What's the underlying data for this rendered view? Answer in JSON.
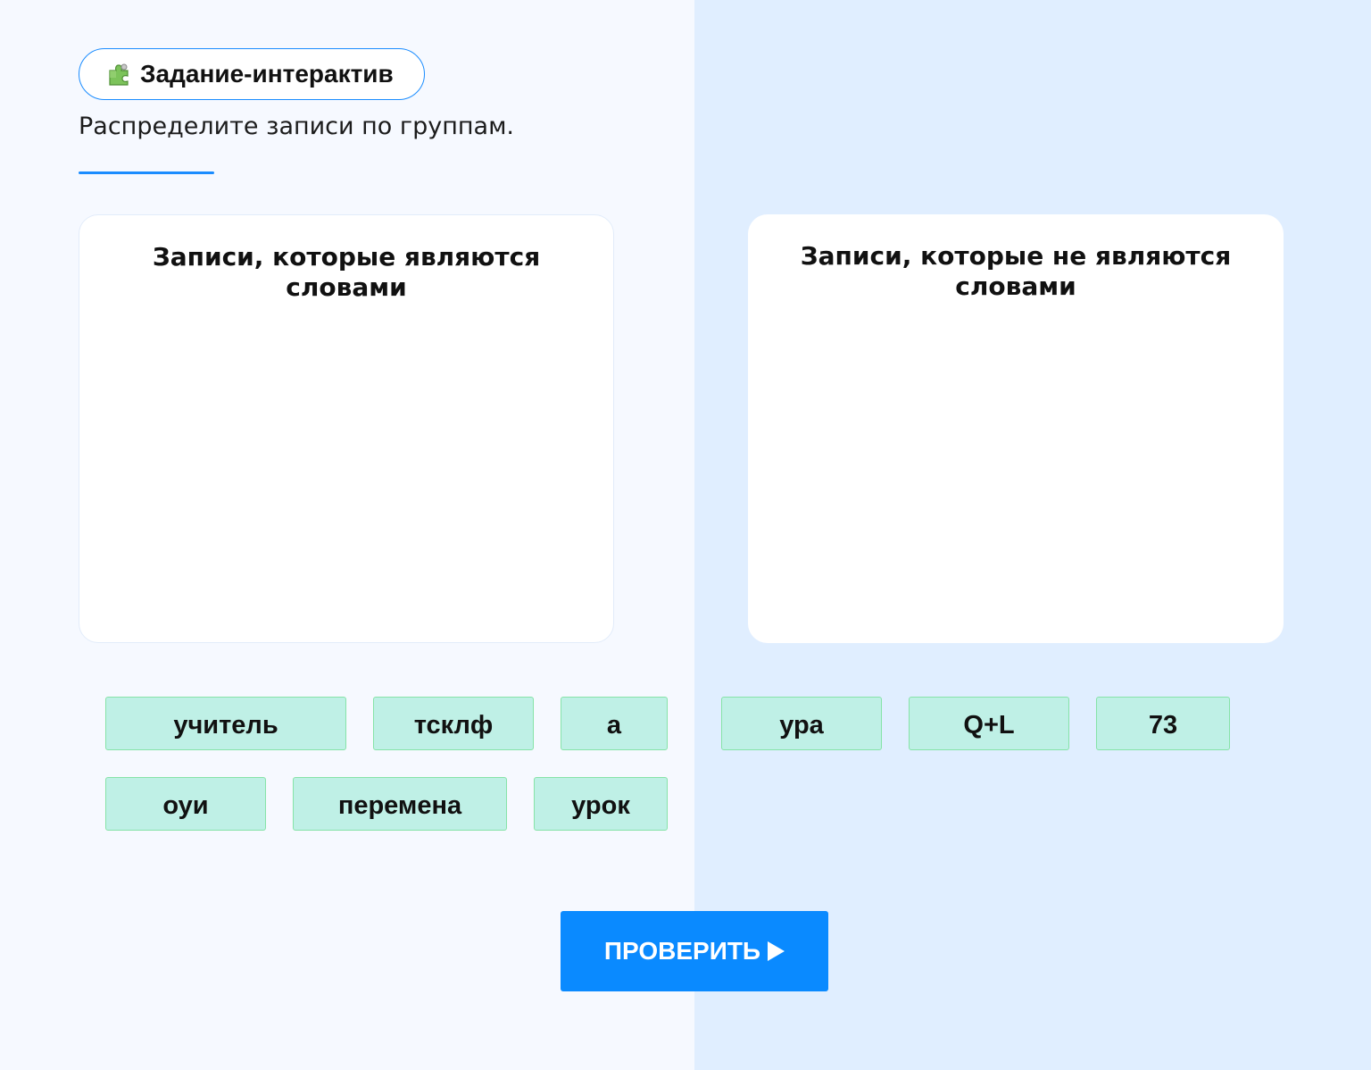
{
  "badge": {
    "icon": "puzzle-icon",
    "label": "Задание-интерактив"
  },
  "instruction": "Распределите записи по группам.",
  "groups": [
    {
      "title": "Записи, которые являются словами"
    },
    {
      "title": "Записи, которые не являются словами"
    }
  ],
  "chips": [
    {
      "label": "учитель"
    },
    {
      "label": "тсклф"
    },
    {
      "label": "а"
    },
    {
      "label": "ура"
    },
    {
      "label": "Q+L"
    },
    {
      "label": "73"
    },
    {
      "label": "оуи"
    },
    {
      "label": "перемена"
    },
    {
      "label": "урок"
    }
  ],
  "check_button": {
    "label": "ПРОВЕРИТЬ",
    "icon": "play-icon"
  },
  "colors": {
    "accent": "#1a8cff",
    "button": "#0a8aff",
    "chip_fill": "#bff0e6",
    "chip_border": "#86e3a8",
    "left_bg": "#f6f9ff",
    "right_bg": "#e0eeff"
  }
}
